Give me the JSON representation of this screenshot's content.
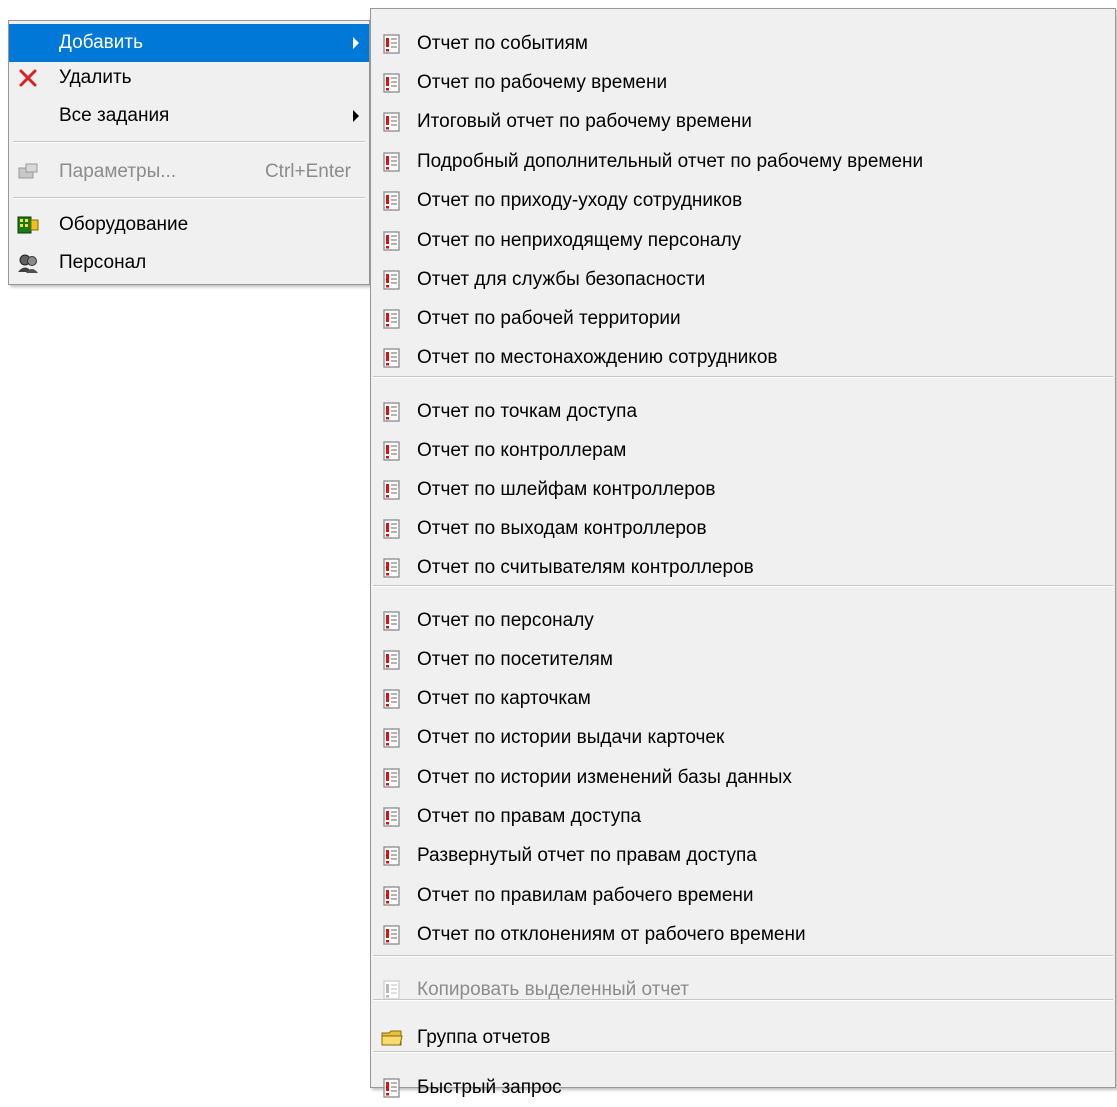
{
  "main_menu": {
    "items": [
      {
        "label": "Добавить",
        "icon": "none",
        "submenu": true,
        "highlighted": true
      },
      {
        "label": "Удалить",
        "icon": "red-x-icon"
      },
      {
        "label": "Все задания",
        "icon": "none",
        "submenu": true
      },
      {
        "label": "Параметры...",
        "shortcut": "Ctrl+Enter",
        "icon": "properties-icon",
        "disabled": true
      },
      {
        "label": "Оборудование",
        "icon": "equipment-icon"
      },
      {
        "label": "Персонал",
        "icon": "personnel-icon"
      }
    ]
  },
  "submenu": {
    "items": [
      {
        "label": "Отчет по событиям",
        "icon": "report-icon"
      },
      {
        "label": "Отчет по рабочему времени",
        "icon": "report-icon"
      },
      {
        "label": "Итоговый отчет по рабочему времени",
        "icon": "report-icon"
      },
      {
        "label": "Подробный дополнительный отчет по рабочему времени",
        "icon": "report-icon"
      },
      {
        "label": "Отчет по приходу-уходу сотрудников",
        "icon": "report-icon"
      },
      {
        "label": "Отчет по неприходящему персоналу",
        "icon": "report-icon"
      },
      {
        "label": "Отчет для службы безопасности",
        "icon": "report-icon"
      },
      {
        "label": "Отчет по рабочей территории",
        "icon": "report-icon"
      },
      {
        "label": "Отчет по местонахождению сотрудников",
        "icon": "report-icon"
      },
      {
        "label": "Отчет по точкам доступа",
        "icon": "report-icon"
      },
      {
        "label": "Отчет по контроллерам",
        "icon": "report-icon"
      },
      {
        "label": "Отчет по шлейфам контроллеров",
        "icon": "report-icon"
      },
      {
        "label": "Отчет по выходам контроллеров",
        "icon": "report-icon"
      },
      {
        "label": "Отчет по считывателям контроллеров",
        "icon": "report-icon"
      },
      {
        "label": "Отчет по персоналу",
        "icon": "report-icon"
      },
      {
        "label": "Отчет по посетителям",
        "icon": "report-icon"
      },
      {
        "label": "Отчет по карточкам",
        "icon": "report-icon"
      },
      {
        "label": "Отчет по истории выдачи карточек",
        "icon": "report-icon"
      },
      {
        "label": "Отчет по истории изменений базы данных",
        "icon": "report-icon"
      },
      {
        "label": "Отчет по правам доступа",
        "icon": "report-icon"
      },
      {
        "label": "Развернутый отчет по правам доступа",
        "icon": "report-icon"
      },
      {
        "label": "Отчет по правилам рабочего времени",
        "icon": "report-icon"
      },
      {
        "label": "Отчет по отклонениям от рабочего времени",
        "icon": "report-icon"
      },
      {
        "label": "Копировать выделенный отчет",
        "icon": "report-icon",
        "disabled": true
      },
      {
        "label": "Группа отчетов",
        "icon": "folder-icon"
      },
      {
        "label": "Быстрый запрос",
        "icon": "report-icon"
      }
    ]
  },
  "colors": {
    "menu_bg": "#f0f0f0",
    "highlight": "#0078d7",
    "disabled_text": "#8c8c8c",
    "report_icon_accent": "#e01010"
  }
}
